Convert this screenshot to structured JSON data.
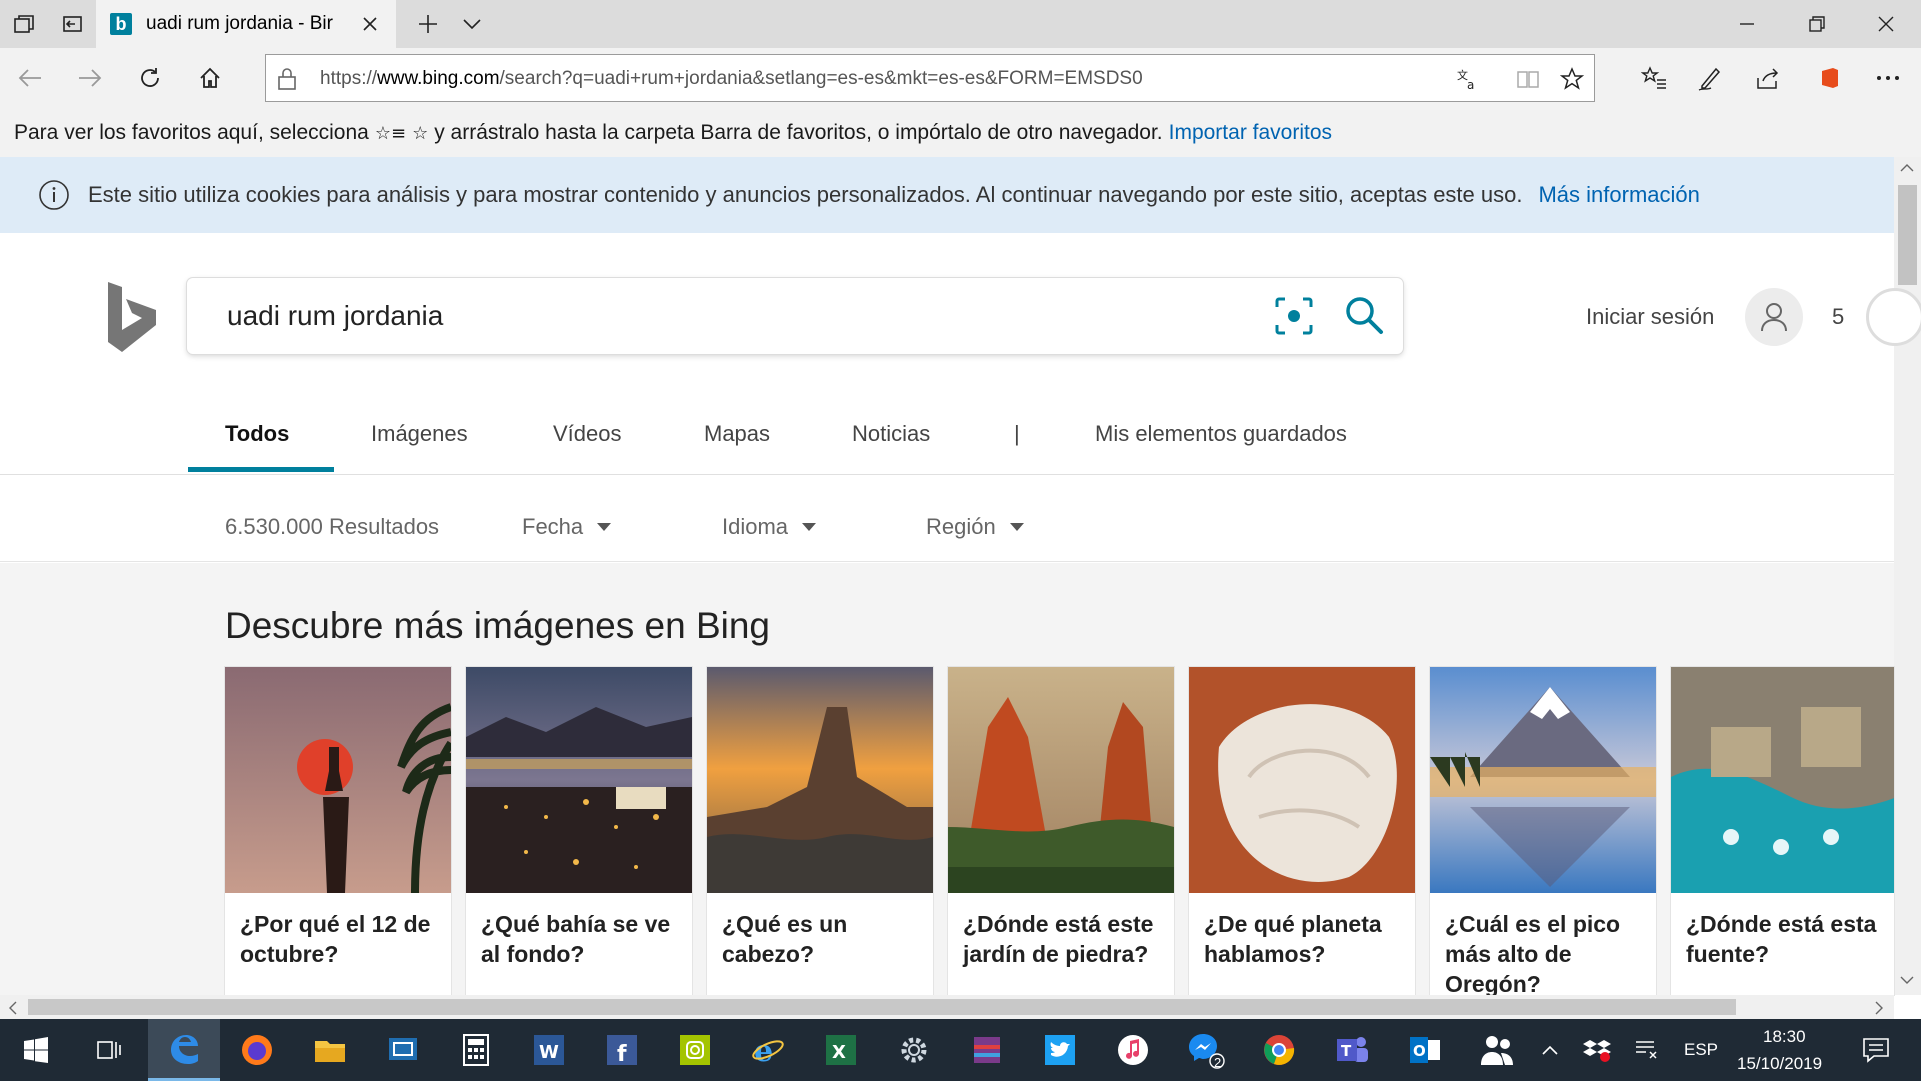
{
  "browser": {
    "tab_title": "uadi rum jordania - Bir",
    "url_prefix": "https://",
    "url_host": "www.bing.com",
    "url_rest": "/search?q=uadi+rum+jordania&setlang=es-es&mkt=es-es&FORM=EMSDS0"
  },
  "favorites_bar": {
    "text_before": "Para ver los favoritos aquí, selecciona",
    "icon_glyph": "☆",
    "text_after": "y arrástralo hasta la carpeta Barra de favoritos, o impórtalo de otro navegador.",
    "import_link": "Importar favoritos"
  },
  "cookie_banner": {
    "message": "Este sitio utiliza cookies para análisis y para mostrar contenido y anuncios personalizados. Al continuar navegando por este sitio, aceptas este uso.",
    "link": "Más información"
  },
  "bing": {
    "query": "uadi rum jordania",
    "signin": "Iniciar sesión",
    "rewards_count": "5",
    "accent_color": "#00809d"
  },
  "scopes": [
    {
      "label": "Todos",
      "active": true
    },
    {
      "label": "Imágenes",
      "active": false
    },
    {
      "label": "Vídeos",
      "active": false
    },
    {
      "label": "Mapas",
      "active": false
    },
    {
      "label": "Noticias",
      "active": false
    },
    {
      "label": "|",
      "active": false
    },
    {
      "label": "Mis elementos guardados",
      "active": false
    }
  ],
  "filters": {
    "results": "6.530.000 Resultados",
    "date": "Fecha",
    "language": "Idioma",
    "region": "Región"
  },
  "discover": {
    "title": "Descubre más imágenes en Bing",
    "cards": [
      {
        "question": "¿Por qué el 12 de octubre?"
      },
      {
        "question": "¿Qué bahía se ve al fondo?"
      },
      {
        "question": "¿Qué es un cabezo?"
      },
      {
        "question": "¿Dónde está este jardín de piedra?"
      },
      {
        "question": "¿De qué planeta hablamos?"
      },
      {
        "question": "¿Cuál es el pico más alto de Oregón?"
      },
      {
        "question": "¿Dónde está esta fuente?"
      }
    ]
  },
  "taskbar": {
    "language": "ESP",
    "time": "18:30",
    "date": "15/10/2019",
    "messenger_badge": "2"
  }
}
